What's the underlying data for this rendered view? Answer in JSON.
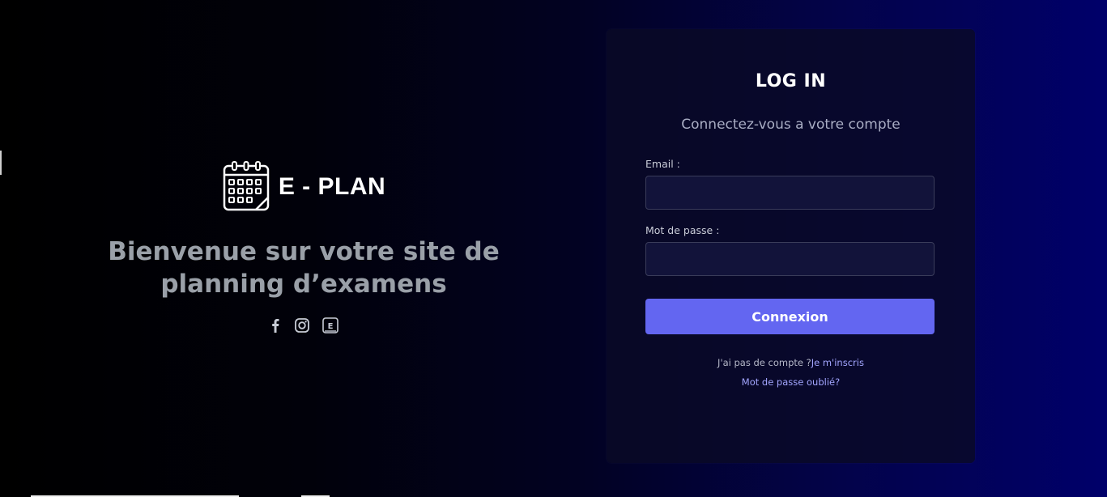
{
  "brand": {
    "name": "E - PLAN",
    "icon": "calendar-icon"
  },
  "hero": {
    "headline_line1": "Bienvenue sur votre site de",
    "headline_line2": "planning d’examens"
  },
  "socials": [
    {
      "name": "facebook-icon"
    },
    {
      "name": "instagram-icon"
    },
    {
      "name": "e-icon",
      "glyph": "E"
    }
  ],
  "login": {
    "title": "LOG IN",
    "subtitle": "Connectez-vous a votre compte",
    "email_label": "Email :",
    "email_value": "",
    "password_label": "Mot de passe :",
    "password_value": "",
    "submit_label": "Connexion",
    "no_account_text": "J'ai pas de compte ?",
    "signup_link": "Je m'inscris",
    "forgot_link": "Mot de passe oublié?"
  },
  "colors": {
    "accent": "#6366f1",
    "link": "#a3a6ff",
    "headline": "#9aa0a8"
  }
}
